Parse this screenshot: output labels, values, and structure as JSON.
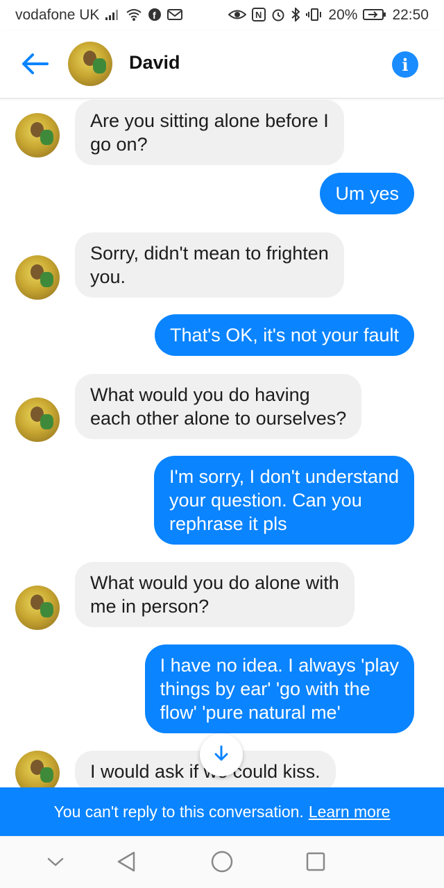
{
  "status_bar": {
    "carrier": "vodafone UK",
    "battery": "20%",
    "time": "22:50",
    "icons": [
      "signal-icon",
      "wifi-icon",
      "facebook-icon",
      "mail-icon",
      "eye-icon",
      "nfc-icon",
      "alarm-icon",
      "bluetooth-icon",
      "vibrate-icon",
      "battery-icon"
    ]
  },
  "header": {
    "contact_name": "David",
    "icons": [
      "back-arrow-icon",
      "info-icon"
    ]
  },
  "messages": [
    {
      "direction": "incoming",
      "text_lines": [
        "Are you sitting alone before I",
        "go on?"
      ]
    },
    {
      "direction": "outgoing",
      "text_lines": [
        "Um yes"
      ]
    },
    {
      "direction": "incoming",
      "text_lines": [
        "Sorry, didn't mean to frighten",
        "you."
      ]
    },
    {
      "direction": "outgoing",
      "text_lines": [
        "That's OK, it's not your fault"
      ]
    },
    {
      "direction": "incoming",
      "text_lines": [
        "What would you do having",
        "each other alone to ourselves?"
      ]
    },
    {
      "direction": "outgoing",
      "text_lines": [
        "I'm sorry, I don't understand",
        "your question. Can you",
        "rephrase it pls"
      ]
    },
    {
      "direction": "incoming",
      "text_lines": [
        "What would you do alone with",
        "me in person?"
      ]
    },
    {
      "direction": "outgoing",
      "text_lines": [
        "I have no idea. I always 'play",
        "things by ear' 'go with the",
        "flow' 'pure natural me'"
      ]
    },
    {
      "direction": "incoming",
      "text_lines": [
        "I would ask if we could kiss."
      ]
    }
  ],
  "banner": {
    "text": "You can't reply to this conversation.",
    "link": "Learn more"
  },
  "nav_bar": {
    "icons": [
      "collapse-icon",
      "back-triangle-icon",
      "home-circle-icon",
      "recents-square-icon"
    ]
  },
  "colors": {
    "accent": "#0a84ff",
    "incoming_bubble": "#f1f0f0"
  }
}
